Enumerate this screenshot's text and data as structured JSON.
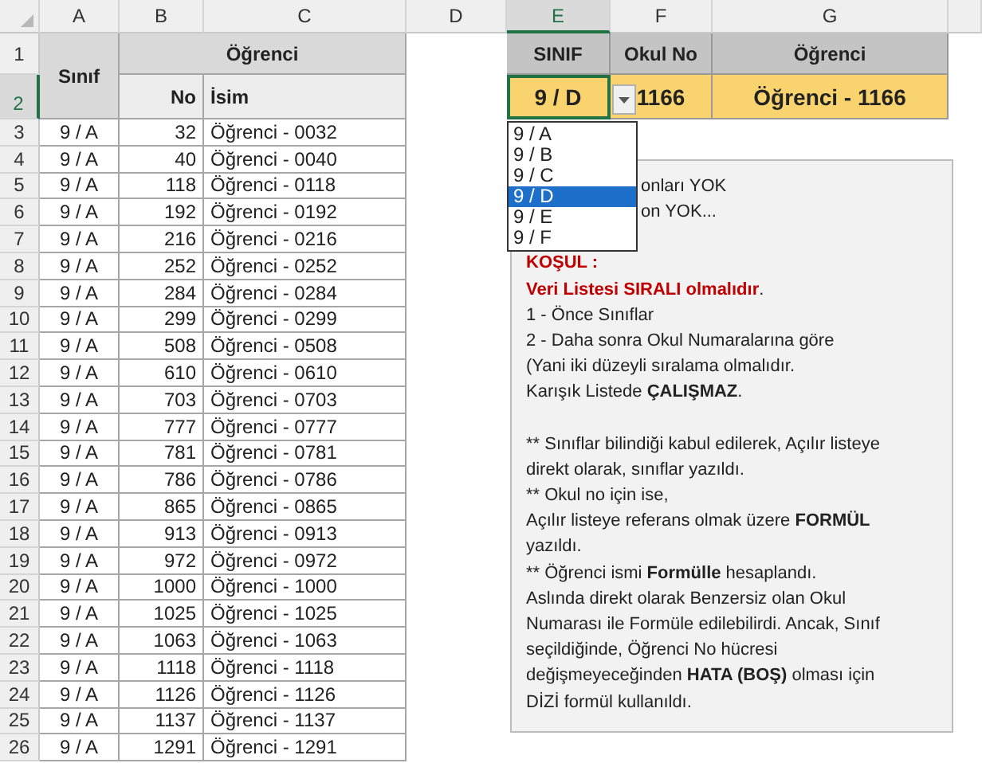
{
  "column_headers": [
    {
      "label": "A",
      "selected": false
    },
    {
      "label": "B",
      "selected": false
    },
    {
      "label": "C",
      "selected": false
    },
    {
      "label": "D",
      "selected": false
    },
    {
      "label": "E",
      "selected": true
    },
    {
      "label": "F",
      "selected": false
    },
    {
      "label": "G",
      "selected": false
    }
  ],
  "row_headers": [
    {
      "label": "1",
      "selected": false
    },
    {
      "label": "2",
      "selected": true
    },
    {
      "label": "3",
      "selected": false
    },
    {
      "label": "4",
      "selected": false
    },
    {
      "label": "5",
      "selected": false
    },
    {
      "label": "6",
      "selected": false
    },
    {
      "label": "7",
      "selected": false
    },
    {
      "label": "8",
      "selected": false
    },
    {
      "label": "9",
      "selected": false
    },
    {
      "label": "10",
      "selected": false
    },
    {
      "label": "11",
      "selected": false
    },
    {
      "label": "12",
      "selected": false
    },
    {
      "label": "13",
      "selected": false
    },
    {
      "label": "14",
      "selected": false
    },
    {
      "label": "15",
      "selected": false
    },
    {
      "label": "16",
      "selected": false
    },
    {
      "label": "17",
      "selected": false
    },
    {
      "label": "18",
      "selected": false
    },
    {
      "label": "19",
      "selected": false
    },
    {
      "label": "20",
      "selected": false
    },
    {
      "label": "21",
      "selected": false
    },
    {
      "label": "22",
      "selected": false
    },
    {
      "label": "23",
      "selected": false
    },
    {
      "label": "24",
      "selected": false
    },
    {
      "label": "25",
      "selected": false
    },
    {
      "label": "26",
      "selected": false
    }
  ],
  "students_table": {
    "class_header": "Sınıf",
    "student_header": "Öğrenci",
    "no_header": "No",
    "name_header": "İsim",
    "rows": [
      {
        "class": "9 / A",
        "no": "32",
        "name": "Öğrenci - 0032"
      },
      {
        "class": "9 / A",
        "no": "40",
        "name": "Öğrenci - 0040"
      },
      {
        "class": "9 / A",
        "no": "118",
        "name": "Öğrenci - 0118"
      },
      {
        "class": "9 / A",
        "no": "192",
        "name": "Öğrenci - 0192"
      },
      {
        "class": "9 / A",
        "no": "216",
        "name": "Öğrenci - 0216"
      },
      {
        "class": "9 / A",
        "no": "252",
        "name": "Öğrenci - 0252"
      },
      {
        "class": "9 / A",
        "no": "284",
        "name": "Öğrenci - 0284"
      },
      {
        "class": "9 / A",
        "no": "299",
        "name": "Öğrenci - 0299"
      },
      {
        "class": "9 / A",
        "no": "508",
        "name": "Öğrenci - 0508"
      },
      {
        "class": "9 / A",
        "no": "610",
        "name": "Öğrenci - 0610"
      },
      {
        "class": "9 / A",
        "no": "703",
        "name": "Öğrenci - 0703"
      },
      {
        "class": "9 / A",
        "no": "777",
        "name": "Öğrenci - 0777"
      },
      {
        "class": "9 / A",
        "no": "781",
        "name": "Öğrenci - 0781"
      },
      {
        "class": "9 / A",
        "no": "786",
        "name": "Öğrenci - 0786"
      },
      {
        "class": "9 / A",
        "no": "865",
        "name": "Öğrenci - 0865"
      },
      {
        "class": "9 / A",
        "no": "913",
        "name": "Öğrenci - 0913"
      },
      {
        "class": "9 / A",
        "no": "972",
        "name": "Öğrenci - 0972"
      },
      {
        "class": "9 / A",
        "no": "1000",
        "name": "Öğrenci - 1000"
      },
      {
        "class": "9 / A",
        "no": "1025",
        "name": "Öğrenci - 1025"
      },
      {
        "class": "9 / A",
        "no": "1063",
        "name": "Öğrenci - 1063"
      },
      {
        "class": "9 / A",
        "no": "1118",
        "name": "Öğrenci - 1118"
      },
      {
        "class": "9 / A",
        "no": "1126",
        "name": "Öğrenci - 1126"
      },
      {
        "class": "9 / A",
        "no": "1137",
        "name": "Öğrenci - 1137"
      },
      {
        "class": "9 / A",
        "no": "1291",
        "name": "Öğrenci - 1291"
      }
    ]
  },
  "lookup": {
    "class_header": "SINIF",
    "no_header": "Okul No",
    "name_header": "Öğrenci",
    "class_value": "9 / D",
    "no_value": "1166",
    "name_value": "Öğrenci - 1166"
  },
  "dropdown": {
    "options": [
      {
        "label": "9 / A",
        "selected": false
      },
      {
        "label": "9 / B",
        "selected": false
      },
      {
        "label": "9 / C",
        "selected": false
      },
      {
        "label": "9 / D",
        "selected": true
      },
      {
        "label": "9 / E",
        "selected": false
      },
      {
        "label": "9 / F",
        "selected": false
      }
    ]
  },
  "note": {
    "paragraphs": [
      {
        "kind": "covered",
        "lines": [
          [
            {
              "text": "onları YOK",
              "bold": false
            }
          ],
          [
            {
              "text": "on YOK...",
              "bold": false
            }
          ]
        ]
      },
      {
        "kind": "warning",
        "lines": [
          [
            {
              "text": "KOŞUL :",
              "bold": true
            }
          ],
          [
            {
              "text": "Veri Listesi SIRALI olmalıdır",
              "bold": true
            },
            {
              "text": ".",
              "bold": false
            }
          ],
          [
            {
              "text": "1 - Önce Sınıflar",
              "bold": false
            }
          ],
          [
            {
              "text": "2 - Daha sonra Okul Numaralarına göre",
              "bold": false
            }
          ],
          [
            {
              "text": "(Yani iki düzeyli sıralama olmalıdır.",
              "bold": false
            }
          ],
          [
            {
              "text": "Karışık Listede ",
              "bold": false
            },
            {
              "text": "ÇALIŞMAZ",
              "bold": true
            },
            {
              "text": ".",
              "bold": false
            }
          ]
        ]
      },
      {
        "kind": "normal",
        "lines": [
          [
            {
              "text": "** Sınıflar bilindiği kabul edilerek, Açılır listeye",
              "bold": false
            }
          ],
          [
            {
              "text": "direkt olarak, sınıflar yazıldı.",
              "bold": false
            }
          ],
          [
            {
              "text": "** Okul no için ise,",
              "bold": false
            }
          ],
          [
            {
              "text": "Açılır listeye referans olmak üzere ",
              "bold": false
            },
            {
              "text": "FORMÜL",
              "bold": true
            }
          ],
          [
            {
              "text": "yazıldı.",
              "bold": false
            }
          ],
          [
            {
              "text": "** Öğrenci ismi ",
              "bold": false
            },
            {
              "text": "Formülle",
              "bold": true
            },
            {
              "text": " hesaplandı.",
              "bold": false
            }
          ],
          [
            {
              "text": "Aslında direkt olarak Benzersiz olan Okul",
              "bold": false
            }
          ],
          [
            {
              "text": "Numarası ile Formüle edilebilirdi. Ancak, Sınıf",
              "bold": false
            }
          ],
          [
            {
              "text": "seçildiğinde, Öğrenci No hücresi",
              "bold": false
            }
          ],
          [
            {
              "text": "değişmeyeceğinden ",
              "bold": false
            },
            {
              "text": "HATA (BOŞ)",
              "bold": true
            },
            {
              "text": " olması için",
              "bold": false
            }
          ],
          [
            {
              "text": "DİZİ formül kullanıldı.",
              "bold": false
            }
          ]
        ]
      }
    ]
  }
}
